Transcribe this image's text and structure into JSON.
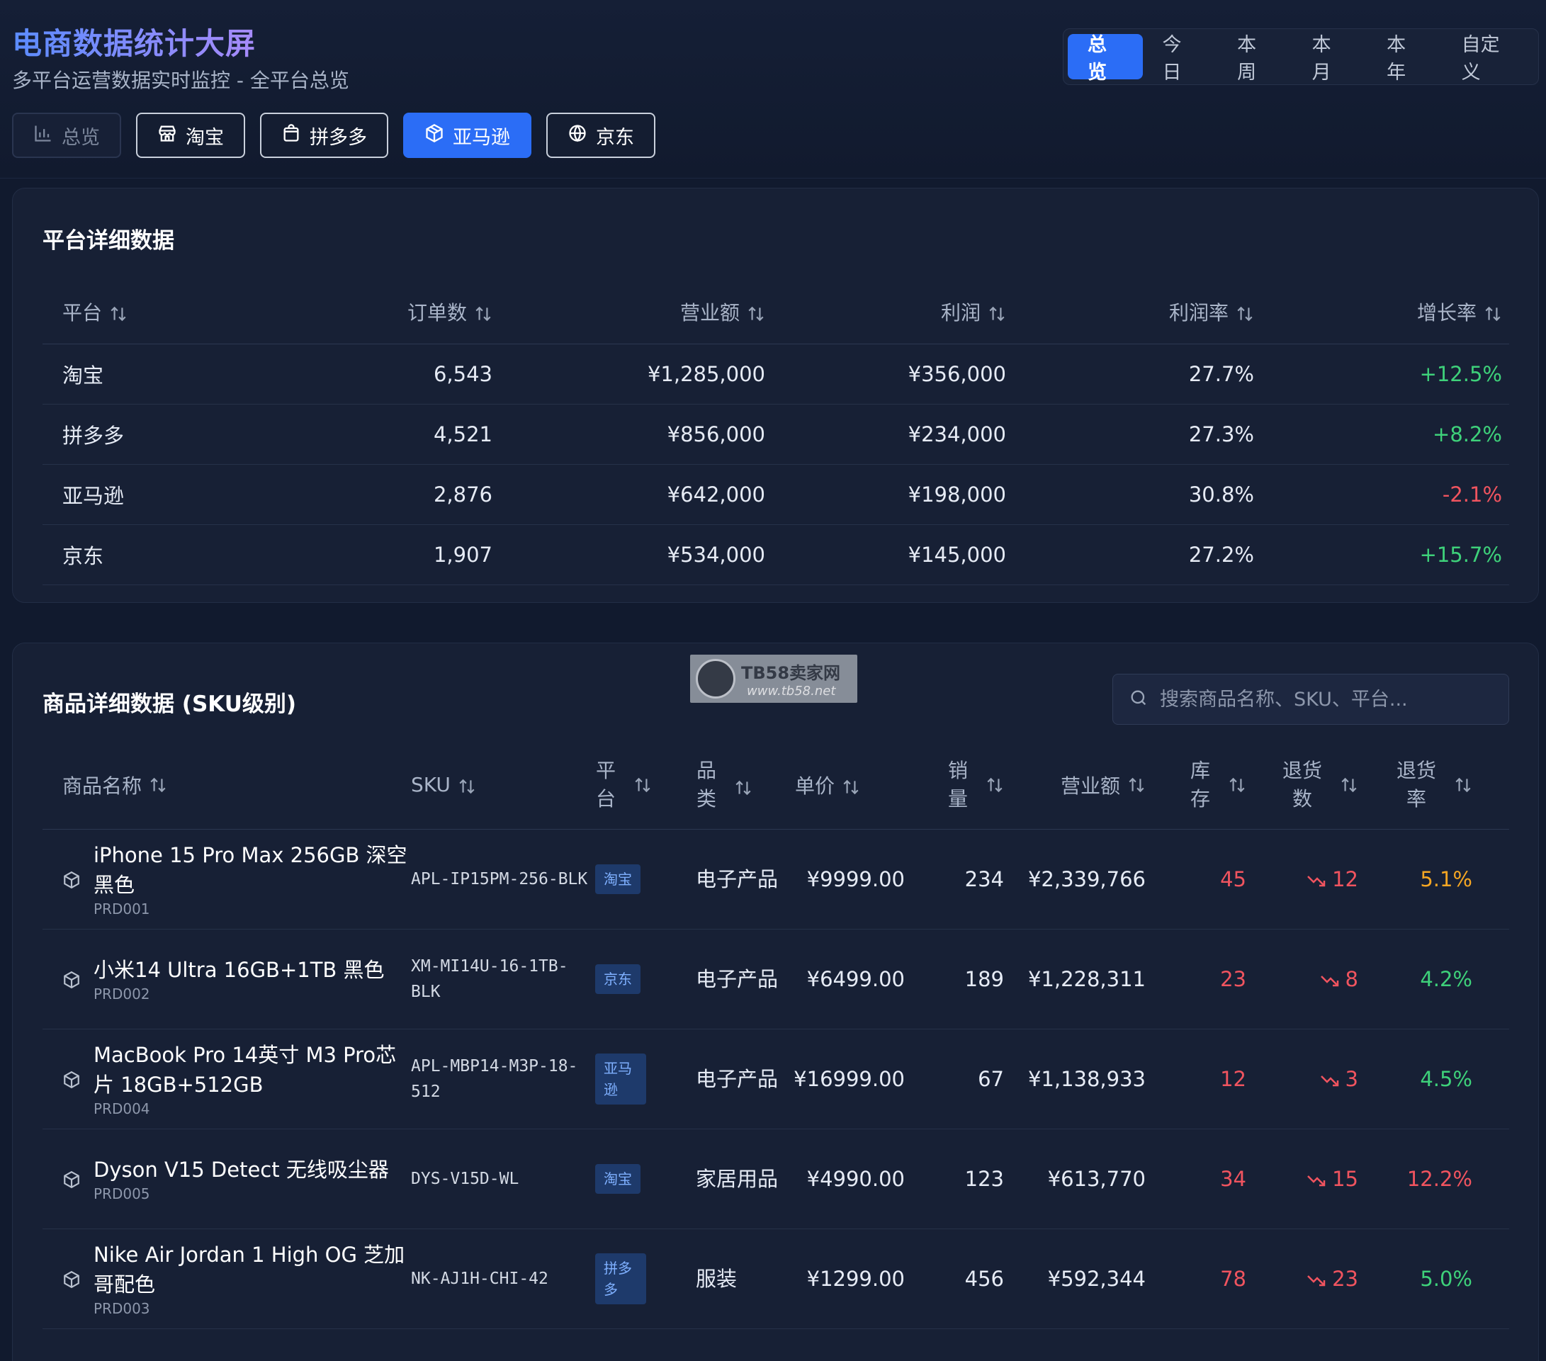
{
  "header": {
    "title": "电商数据统计大屏",
    "subtitle": "多平台运营数据实时监控 - 全平台总览"
  },
  "period_tabs": [
    {
      "label": "总览",
      "active": true
    },
    {
      "label": "今日",
      "active": false
    },
    {
      "label": "本周",
      "active": false
    },
    {
      "label": "本月",
      "active": false
    },
    {
      "label": "本年",
      "active": false
    },
    {
      "label": "自定义",
      "active": false
    }
  ],
  "platform_tabs": [
    {
      "label": "总览",
      "icon": "bar-chart-icon",
      "state": "disabled"
    },
    {
      "label": "淘宝",
      "icon": "store-icon",
      "state": "normal"
    },
    {
      "label": "拼多多",
      "icon": "shopping-bag-icon",
      "state": "normal"
    },
    {
      "label": "亚马逊",
      "icon": "package-icon",
      "state": "active"
    },
    {
      "label": "京东",
      "icon": "globe-icon",
      "state": "normal"
    }
  ],
  "platform_table": {
    "title": "平台详细数据",
    "columns": [
      "平台",
      "订单数",
      "营业额",
      "利润",
      "利润率",
      "增长率"
    ],
    "rows": [
      [
        "淘宝",
        "6,543",
        "¥1,285,000",
        "¥356,000",
        "27.7%",
        "+12.5%"
      ],
      [
        "拼多多",
        "4,521",
        "¥856,000",
        "¥234,000",
        "27.3%",
        "+8.2%"
      ],
      [
        "亚马逊",
        "2,876",
        "¥642,000",
        "¥198,000",
        "30.8%",
        "-2.1%"
      ],
      [
        "京东",
        "1,907",
        "¥534,000",
        "¥145,000",
        "27.2%",
        "+15.7%"
      ]
    ]
  },
  "sku_table": {
    "title": "商品详细数据 (SKU级别)",
    "search_placeholder": "搜索商品名称、SKU、平台...",
    "watermark": {
      "name": "TB58卖家网",
      "url": "www.tb58.net"
    },
    "columns": [
      "商品名称",
      "SKU",
      "平台",
      "品类",
      "单价",
      "销量",
      "营业额",
      "库存",
      "退货数",
      "退货率"
    ],
    "rows": [
      {
        "name": "iPhone 15 Pro Max 256GB 深空黑色",
        "id": "PRD001",
        "sku": "APL-IP15PM-256-BLK",
        "platform": "淘宝",
        "category": "电子产品",
        "price": "¥9999.00",
        "sales": "234",
        "revenue": "¥2,339,766",
        "stock": "45",
        "returns": "12",
        "return_rate": "5.1%",
        "rate_color": "#f5a623"
      },
      {
        "name": "小米14 Ultra 16GB+1TB 黑色",
        "id": "PRD002",
        "sku": "XM-MI14U-16-1TB-BLK",
        "platform": "京东",
        "category": "电子产品",
        "price": "¥6499.00",
        "sales": "189",
        "revenue": "¥1,228,311",
        "stock": "23",
        "returns": "8",
        "return_rate": "4.2%",
        "rate_color": "#3ed17a"
      },
      {
        "name": "MacBook Pro 14英寸 M3 Pro芯片 18GB+512GB",
        "id": "PRD004",
        "sku": "APL-MBP14-M3P-18-512",
        "platform": "亚马逊",
        "category": "电子产品",
        "price": "¥16999.00",
        "sales": "67",
        "revenue": "¥1,138,933",
        "stock": "12",
        "returns": "3",
        "return_rate": "4.5%",
        "rate_color": "#3ed17a"
      },
      {
        "name": "Dyson V15 Detect 无线吸尘器",
        "id": "PRD005",
        "sku": "DYS-V15D-WL",
        "platform": "淘宝",
        "category": "家居用品",
        "price": "¥4990.00",
        "sales": "123",
        "revenue": "¥613,770",
        "stock": "34",
        "returns": "15",
        "return_rate": "12.2%",
        "rate_color": "#f0545f"
      },
      {
        "name": "Nike Air Jordan 1 High OG 芝加哥配色",
        "id": "PRD003",
        "sku": "NK-AJ1H-CHI-42",
        "platform": "拼多多",
        "category": "服装",
        "price": "¥1299.00",
        "sales": "456",
        "revenue": "¥592,344",
        "stock": "78",
        "returns": "23",
        "return_rate": "5.0%",
        "rate_color": "#3ed17a"
      }
    ]
  },
  "colors": {
    "accent": "#2b6df6",
    "positive": "#3ed17a",
    "negative": "#f0545f",
    "warning": "#f5a623"
  }
}
